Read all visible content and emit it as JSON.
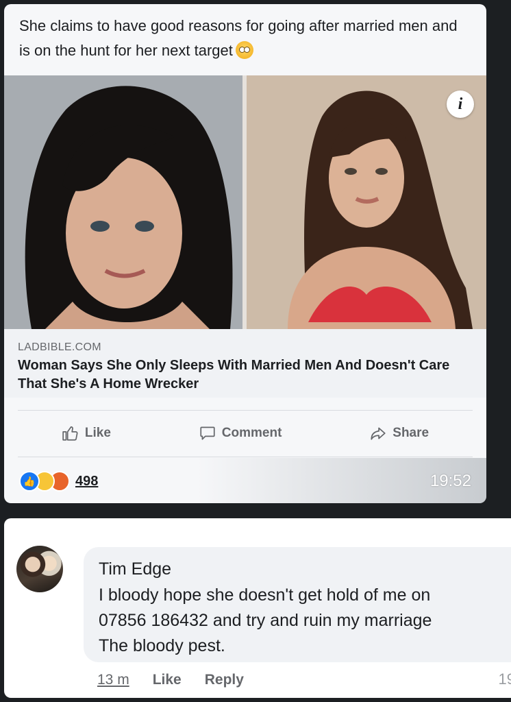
{
  "post": {
    "caption": "She claims to have good reasons for going after married men and is on the hunt for her next target",
    "info_badge": "i",
    "link": {
      "domain": "LADBIBLE.COM",
      "title": "Woman Says She Only Sleeps With Married Men And Doesn't Care That She's A Home Wrecker"
    },
    "actions": {
      "like": "Like",
      "comment": "Comment",
      "share": "Share"
    },
    "reactions": {
      "icons": [
        "like-reaction-icon",
        "haha-reaction-icon",
        "angry-reaction-icon"
      ],
      "count": "498"
    },
    "time": "19:52"
  },
  "comment": {
    "author": "Tim Edge",
    "body": "I bloody hope she doesn't get hold of me on\n07856 186432 and try and ruin my marriage\nThe bloody pest.",
    "time": "13 m",
    "like": "Like",
    "reply": "Reply",
    "edge_time": "19"
  },
  "colors": {
    "link_title": "#1c1e21",
    "meta_gray": "#65676b",
    "like_blue": "#1877f2",
    "card_bg": "#f6f7f9",
    "dark_bg": "#1c1f22"
  }
}
